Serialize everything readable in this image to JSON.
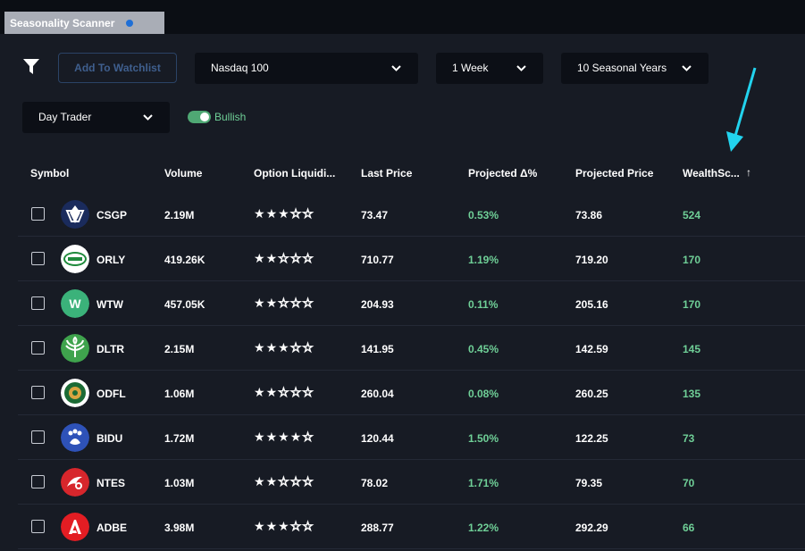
{
  "tab": {
    "title": "Seasonality Scanner",
    "dot_color": "#1f6fd6"
  },
  "toolbar": {
    "watchlist_label": "Add To Watchlist",
    "index_select": "Nasdaq 100",
    "period_select": "1 Week",
    "years_select": "10 Seasonal Years",
    "style_select": "Day Trader",
    "bullish_label": "Bullish",
    "bullish_on": true
  },
  "columns": [
    "Symbol",
    "Volume",
    "Option Liquidi...",
    "Last Price",
    "Projected Δ%",
    "Projected Price",
    "WealthSc..."
  ],
  "sort_indicator": "↑",
  "rows": [
    {
      "symbol": "CSGP",
      "volume": "2.19M",
      "stars": 3,
      "last": "73.47",
      "delta": "0.53%",
      "proj": "73.86",
      "score": "524",
      "logo": "csgp-logo"
    },
    {
      "symbol": "ORLY",
      "volume": "419.26K",
      "stars": 2,
      "last": "710.77",
      "delta": "1.19%",
      "proj": "719.20",
      "score": "170",
      "logo": "orly-logo"
    },
    {
      "symbol": "WTW",
      "volume": "457.05K",
      "stars": 2,
      "last": "204.93",
      "delta": "0.11%",
      "proj": "205.16",
      "score": "170",
      "logo": "wtw-logo"
    },
    {
      "symbol": "DLTR",
      "volume": "2.15M",
      "stars": 3,
      "last": "141.95",
      "delta": "0.45%",
      "proj": "142.59",
      "score": "145",
      "logo": "dltr-logo"
    },
    {
      "symbol": "ODFL",
      "volume": "1.06M",
      "stars": 2,
      "last": "260.04",
      "delta": "0.08%",
      "proj": "260.25",
      "score": "135",
      "logo": "odfl-logo"
    },
    {
      "symbol": "BIDU",
      "volume": "1.72M",
      "stars": 4,
      "last": "120.44",
      "delta": "1.50%",
      "proj": "122.25",
      "score": "73",
      "logo": "bidu-logo"
    },
    {
      "symbol": "NTES",
      "volume": "1.03M",
      "stars": 2,
      "last": "78.02",
      "delta": "1.71%",
      "proj": "79.35",
      "score": "70",
      "logo": "ntes-logo"
    },
    {
      "symbol": "ADBE",
      "volume": "3.98M",
      "stars": 3,
      "last": "288.77",
      "delta": "1.22%",
      "proj": "292.29",
      "score": "66",
      "logo": "adbe-logo"
    }
  ],
  "colors": {
    "positive": "#6fcf97",
    "annotation_arrow": "#22d3ee"
  }
}
